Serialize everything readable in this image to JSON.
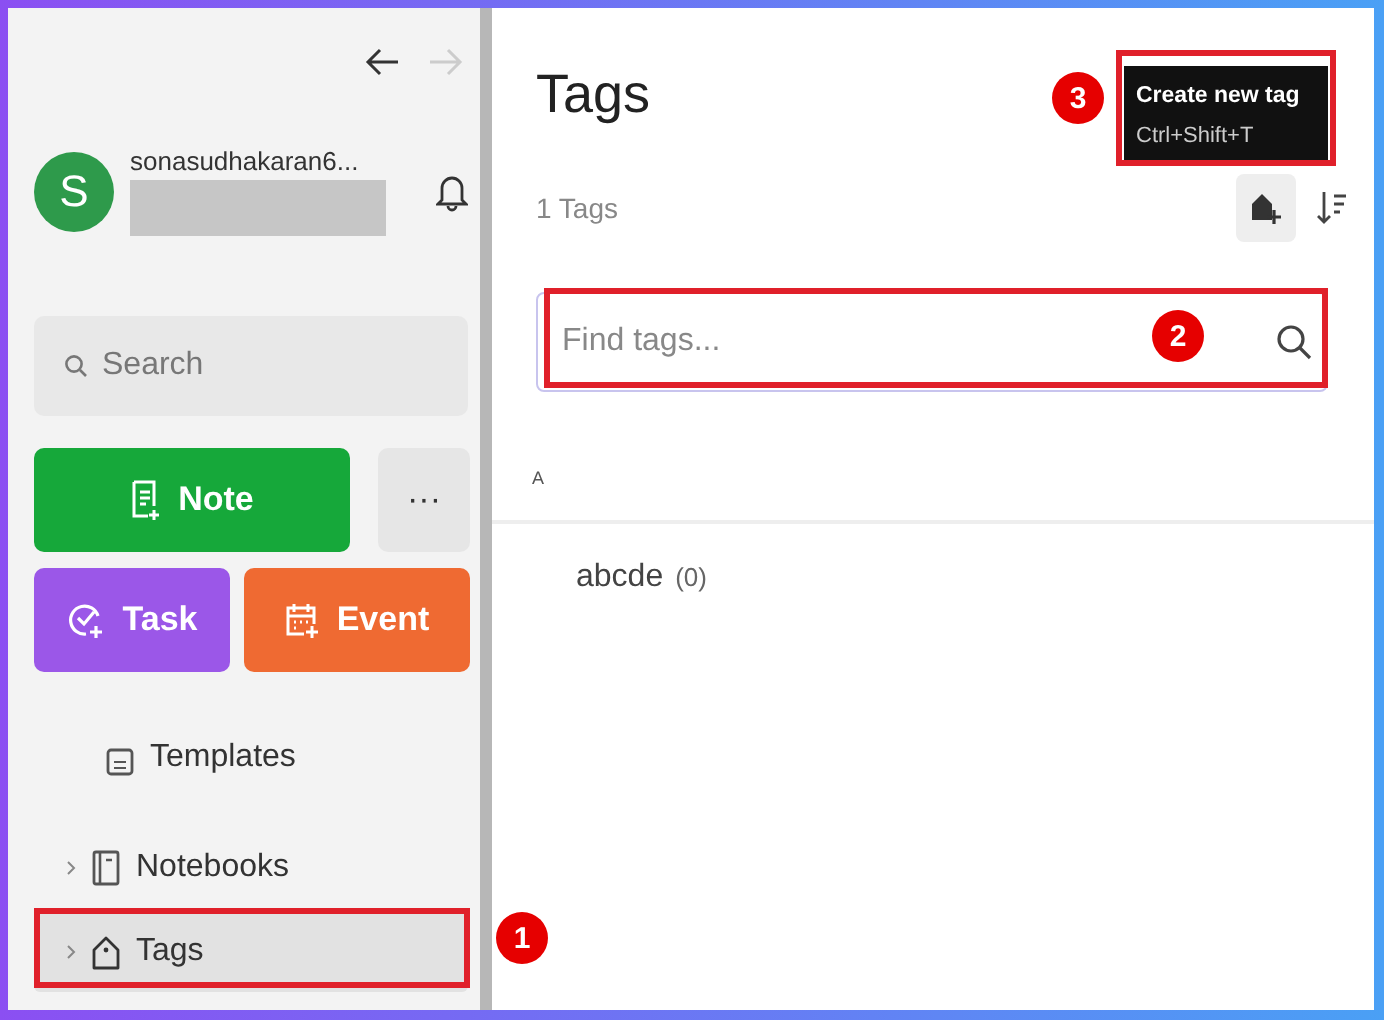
{
  "nav": {
    "back_disabled": false,
    "forward_disabled": true
  },
  "account": {
    "avatar_letter": "S",
    "name": "sonasudhakaran6..."
  },
  "sidebar": {
    "search": {
      "placeholder": "Search"
    },
    "actions": [
      {
        "kind": "note",
        "label": "Note"
      },
      {
        "kind": "more",
        "label": "···"
      },
      {
        "kind": "task",
        "label": "Task"
      },
      {
        "kind": "event",
        "label": "Event"
      }
    ],
    "items": [
      {
        "kind": "templates",
        "label": "Templates",
        "selected": false,
        "expandable": false
      },
      {
        "kind": "notebooks",
        "label": "Notebooks",
        "selected": false,
        "expandable": true
      },
      {
        "kind": "tags",
        "label": "Tags",
        "selected": true,
        "expandable": true
      }
    ]
  },
  "main": {
    "title": "Tags",
    "count": "1 Tags",
    "tooltip": {
      "title": "Create new tag",
      "shortcut": "Ctrl+Shift+T"
    },
    "search": {
      "placeholder": "Find tags..."
    },
    "sections": [
      {
        "letter": "A",
        "tags": [
          {
            "name": "abcde",
            "count": "(0)"
          }
        ]
      }
    ]
  },
  "annotations": [
    {
      "kind": "sidebar_item",
      "number": "1"
    },
    {
      "kind": "search",
      "number": "2"
    },
    {
      "kind": "tooltip",
      "number": "3"
    }
  ]
}
